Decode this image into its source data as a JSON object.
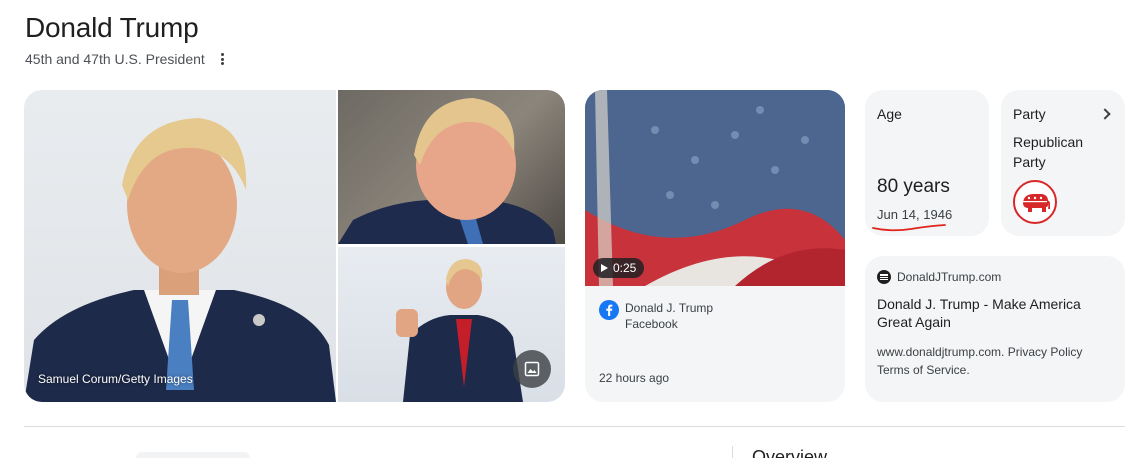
{
  "header": {
    "title": "Donald Trump",
    "subtitle": "45th and 47th U.S. President"
  },
  "gallery": {
    "credit": "Samuel Corum/Getty Images"
  },
  "video": {
    "duration": "0:25",
    "author": "Donald J. Trump",
    "source": "Facebook",
    "posted": "22 hours ago"
  },
  "age": {
    "label": "Age",
    "value": "80 years",
    "birthdate": "Jun 14, 1946"
  },
  "party": {
    "label": "Party",
    "value": "Republican Party"
  },
  "website": {
    "domain": "DonaldJTrump.com",
    "title": "Donald J. Trump - Make America Great Again",
    "description": "www.donaldjtrump.com. Privacy Policy Terms of Service."
  },
  "below": {
    "overview_label": "Overview"
  },
  "colors": {
    "card_bg": "#f3f5f7",
    "gop_red": "#d62828",
    "facebook_blue": "#1877f2",
    "annotation_red": "#e0241b"
  }
}
